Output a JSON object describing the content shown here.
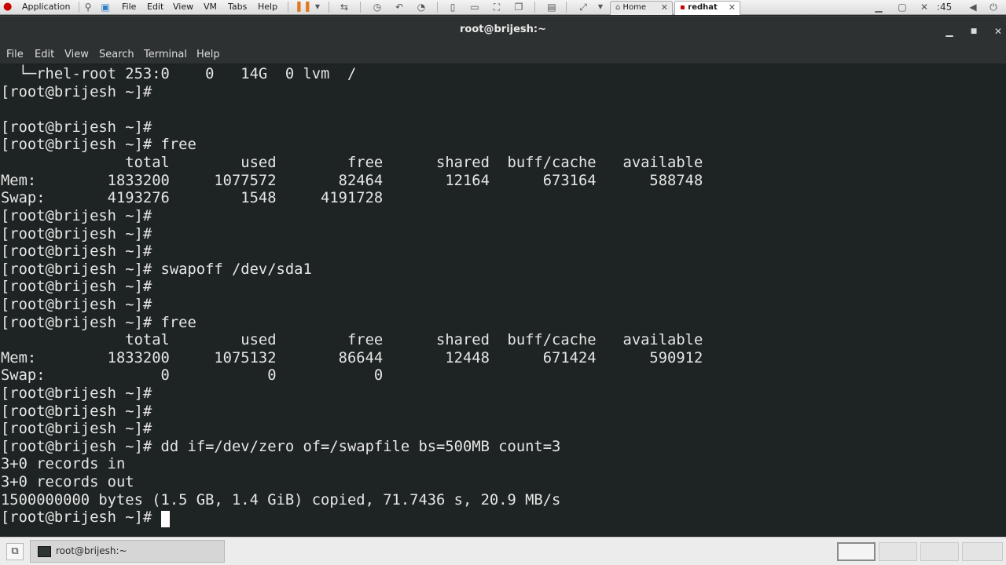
{
  "vm_toolbar": {
    "app_label": "Application",
    "menus": [
      "File",
      "Edit",
      "View",
      "VM",
      "Tabs",
      "Help"
    ],
    "tabs": [
      {
        "label": "Home"
      },
      {
        "label": "redhat"
      }
    ],
    "clock": ":45",
    "close_glyph": "✕"
  },
  "window": {
    "title": "root@brijesh:~"
  },
  "terminal_menu": [
    "File",
    "Edit",
    "View",
    "Search",
    "Terminal",
    "Help"
  ],
  "terminal_lines": [
    "  └─rhel-root 253:0    0   14G  0 lvm  /",
    "[root@brijesh ~]#",
    "",
    "[root@brijesh ~]#",
    "[root@brijesh ~]# free",
    "              total        used        free      shared  buff/cache   available",
    "Mem:        1833200     1077572       82464       12164      673164      588748",
    "Swap:       4193276        1548     4191728",
    "[root@brijesh ~]#",
    "[root@brijesh ~]#",
    "[root@brijesh ~]#",
    "[root@brijesh ~]# swapoff /dev/sda1",
    "[root@brijesh ~]#",
    "[root@brijesh ~]#",
    "[root@brijesh ~]# free",
    "              total        used        free      shared  buff/cache   available",
    "Mem:        1833200     1075132       86644       12448      671424      590912",
    "Swap:             0           0           0",
    "[root@brijesh ~]#",
    "[root@brijesh ~]#",
    "[root@brijesh ~]#",
    "[root@brijesh ~]# dd if=/dev/zero of=/swapfile bs=500MB count=3",
    "3+0 records in",
    "3+0 records out",
    "1500000000 bytes (1.5 GB, 1.4 GiB) copied, 71.7436 s, 20.9 MB/s",
    "[root@brijesh ~]# "
  ],
  "taskbar": {
    "task_label": "root@brijesh:~"
  }
}
